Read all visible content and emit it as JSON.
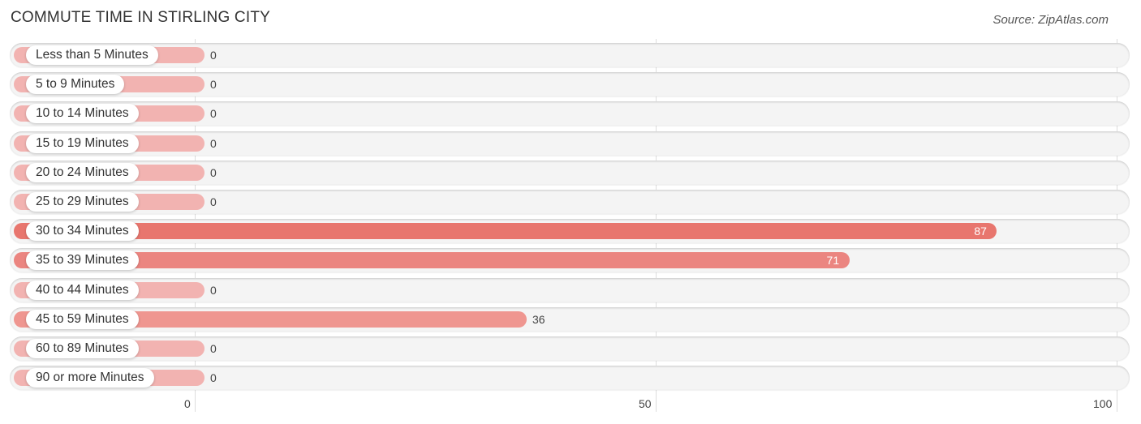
{
  "header": {
    "title": "COMMUTE TIME IN STIRLING CITY",
    "source": "Source: ZipAtlas.com"
  },
  "chart_data": {
    "type": "bar",
    "orientation": "horizontal",
    "title": "COMMUTE TIME IN STIRLING CITY",
    "xlabel": "",
    "ylabel": "",
    "xlim": [
      0,
      100
    ],
    "x_ticks": [
      0,
      50,
      100
    ],
    "grid": true,
    "categories": [
      "Less than 5 Minutes",
      "5 to 9 Minutes",
      "10 to 14 Minutes",
      "15 to 19 Minutes",
      "20 to 24 Minutes",
      "25 to 29 Minutes",
      "30 to 34 Minutes",
      "35 to 39 Minutes",
      "40 to 44 Minutes",
      "45 to 59 Minutes",
      "60 to 89 Minutes",
      "90 or more Minutes"
    ],
    "values": [
      0,
      0,
      0,
      0,
      0,
      0,
      87,
      71,
      0,
      36,
      0,
      0
    ],
    "colors": {
      "high": "#e8766e",
      "mid": "#ef9690",
      "low": "#f2b3b1"
    }
  }
}
